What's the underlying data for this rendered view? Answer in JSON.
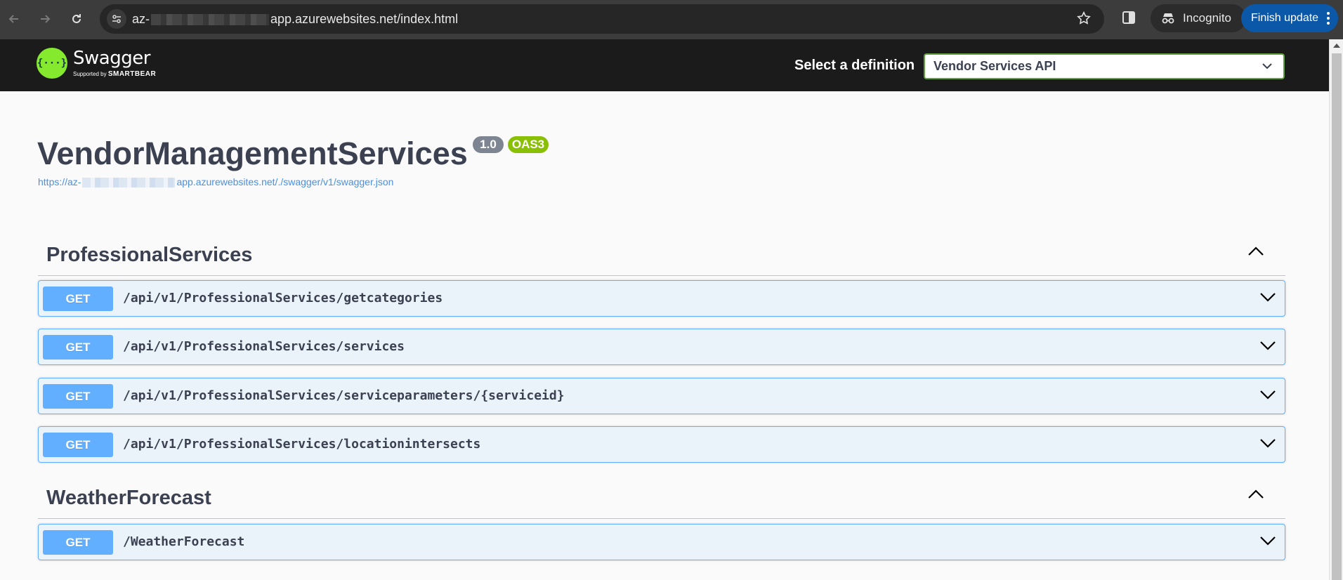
{
  "browser": {
    "url_prefix": "az-",
    "url_suffix": "app.azurewebsites.net/index.html",
    "incognito_label": "Incognito",
    "finish_update_label": "Finish update"
  },
  "topbar": {
    "logo_name": "Swagger",
    "logo_sub_prefix": "Supported by",
    "logo_sub_brand": "SMARTBEAR",
    "definition_label": "Select a definition",
    "definition_value": "Vendor Services API"
  },
  "info": {
    "title": "VendorManagementServices",
    "version": "1.0",
    "oas": "OAS3",
    "spec_url_prefix": "https://az-",
    "spec_url_suffix": "app.azurewebsites.net/./swagger/v1/swagger.json"
  },
  "tags": [
    {
      "name": "ProfessionalServices",
      "operations": [
        {
          "method": "GET",
          "path": "/api/v1/ProfessionalServices/getcategories"
        },
        {
          "method": "GET",
          "path": "/api/v1/ProfessionalServices/services"
        },
        {
          "method": "GET",
          "path": "/api/v1/ProfessionalServices/serviceparameters/{serviceid}"
        },
        {
          "method": "GET",
          "path": "/api/v1/ProfessionalServices/locationintersects"
        }
      ]
    },
    {
      "name": "WeatherForecast",
      "operations": [
        {
          "method": "GET",
          "path": "/WeatherForecast"
        }
      ]
    }
  ],
  "colors": {
    "get_method": "#61affe",
    "swagger_green": "#85ea2d",
    "oas_badge": "#89bf04",
    "version_badge": "#7d8492",
    "finish_update": "#0b57a8"
  }
}
